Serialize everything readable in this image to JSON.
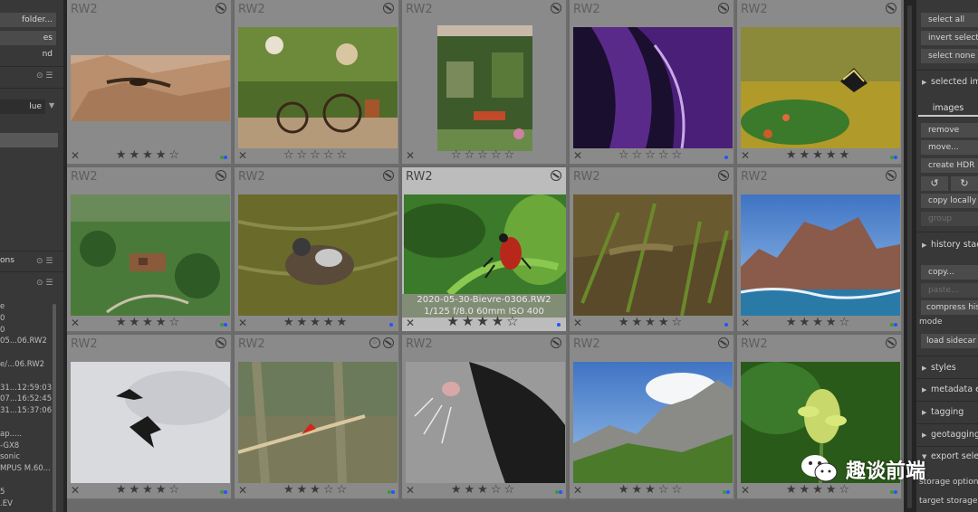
{
  "left_panel": {
    "buttons": [
      "folder...",
      "es",
      "nd"
    ],
    "select_value": "lue",
    "select_arrow": "▼",
    "section_ico_1": "⊙ ☰",
    "section_label": "ons",
    "section_ico_2": "⊙ ☰",
    "section_ico_3": "⊙ ☰",
    "info_lines": "e\n0\n0\n05...06.RW2\n\ne/...06.RW2\n\n31...12:59:03\n07...16:52:45\n31...15:37:06\n\nap.....\n-GX8\nsonic\nMPUS M.60...\n\n5\n.EV"
  },
  "grid": {
    "cells": [
      {
        "ext": "RW2",
        "rating": 4,
        "rejected": false,
        "color": "#3a9a3a",
        "color2": "#2255ff",
        "group": false,
        "hl": false
      },
      {
        "ext": "RW2",
        "rating": 0,
        "rejected": false,
        "color": "",
        "color2": "",
        "group": false,
        "hl": false
      },
      {
        "ext": "RW2",
        "rating": 0,
        "rejected": false,
        "color": "",
        "color2": "",
        "group": false,
        "hl": false
      },
      {
        "ext": "RW2",
        "rating": 0,
        "rejected": false,
        "color": "#2255ff",
        "color2": "",
        "group": false,
        "hl": false
      },
      {
        "ext": "RW2",
        "rating": 5,
        "rejected": false,
        "color": "#3a9a3a",
        "color2": "#2255ff",
        "group": false,
        "hl": false
      },
      {
        "ext": "RW2",
        "rating": 4,
        "rejected": false,
        "color": "#3a9a3a",
        "color2": "#2255ff",
        "group": false,
        "hl": false
      },
      {
        "ext": "RW2",
        "rating": 5,
        "rejected": false,
        "color": "#2255ff",
        "color2": "",
        "group": false,
        "hl": false
      },
      {
        "ext": "RW2",
        "rating": 4,
        "rejected": false,
        "color": "#2255ff",
        "color2": "",
        "group": false,
        "hl": true
      },
      {
        "ext": "RW2",
        "rating": 4,
        "rejected": false,
        "color": "#2255ff",
        "color2": "",
        "group": false,
        "hl": false
      },
      {
        "ext": "RW2",
        "rating": 4,
        "rejected": false,
        "color": "#3a9a3a",
        "color2": "#2255ff",
        "group": false,
        "hl": false
      },
      {
        "ext": "RW2",
        "rating": 4,
        "rejected": false,
        "color": "#3a9a3a",
        "color2": "#2255ff",
        "group": false,
        "hl": false
      },
      {
        "ext": "RW2",
        "rating": 3,
        "rejected": false,
        "color": "#3a9a3a",
        "color2": "#2255ff",
        "group": true,
        "hl": false
      },
      {
        "ext": "RW2",
        "rating": 3,
        "rejected": false,
        "color": "#3a9a3a",
        "color2": "#2255ff",
        "group": false,
        "hl": false
      },
      {
        "ext": "RW2",
        "rating": 3,
        "rejected": false,
        "color": "#3a9a3a",
        "color2": "#2255ff",
        "group": false,
        "hl": false
      },
      {
        "ext": "RW2",
        "rating": 4,
        "rejected": false,
        "color": "#3a9a3a",
        "color2": "#2255ff",
        "group": false,
        "hl": false
      }
    ],
    "hover_filename": "2020-05-30-Bievre-0306.RW2",
    "hover_exif": "1/125 f/8.0 60mm ISO 400",
    "reject_glyph": "✕"
  },
  "right_panel": {
    "buttons_top": [
      "select all",
      "invert selection",
      "select none"
    ],
    "section_selected": "selected images",
    "tab_images": "images",
    "buttons_sel": [
      "remove",
      "move...",
      "create HDR"
    ],
    "icon_btn_1": "↺",
    "icon_btn_2": "↻",
    "btn_copy_locally": "copy locally",
    "btn_group": "group",
    "section_history": "history stack",
    "btn_copy": "copy...",
    "btn_paste": "paste...",
    "btn_compress": "compress history",
    "label_mode": "mode",
    "btn_load_sidecar": "load sidecar file",
    "sections": [
      "styles",
      "metadata editor",
      "tagging",
      "geotagging",
      "export selected"
    ],
    "storage_options": "storage options",
    "target_storage": "target storage"
  },
  "watermark": {
    "text": "趣谈前端"
  }
}
